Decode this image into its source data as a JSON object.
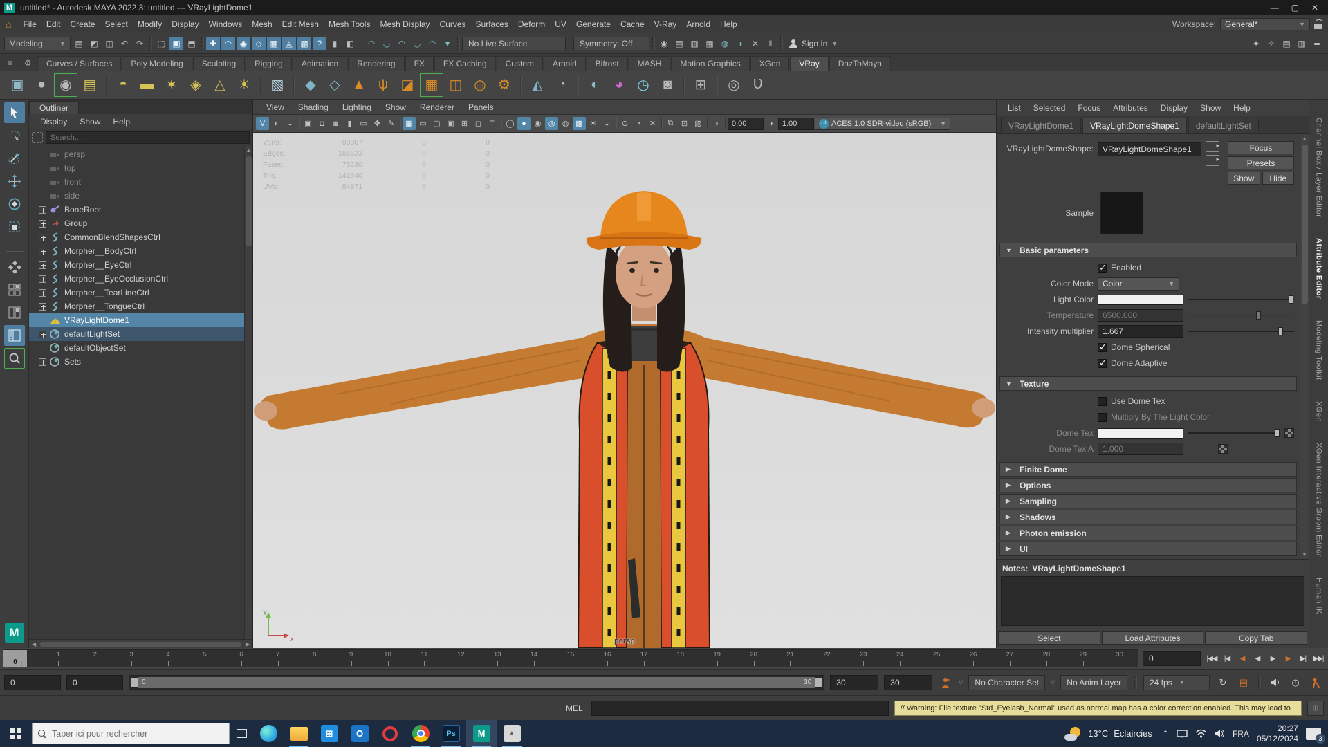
{
  "title_bar": {
    "title": "untitled* - Autodesk MAYA 2022.3: untitled   ---   VRayLightDome1"
  },
  "menu_bar": {
    "items": [
      "File",
      "Edit",
      "Create",
      "Select",
      "Modify",
      "Display",
      "Windows",
      "Mesh",
      "Edit Mesh",
      "Mesh Tools",
      "Mesh Display",
      "Curves",
      "Surfaces",
      "Deform",
      "UV",
      "Generate",
      "Cache",
      "V-Ray",
      "Arnold",
      "Help"
    ],
    "workspace_label": "Workspace:",
    "workspace_value": "General*"
  },
  "status_line": {
    "mode": "Modeling",
    "no_live_surface": "No Live Surface",
    "symmetry": "Symmetry: Off",
    "sign_in": "Sign In",
    "groups": [
      {
        "icons": [
          {
            "n": "new-scene-icon",
            "g": "▤"
          },
          {
            "n": "open-scene-icon",
            "g": "◩"
          },
          {
            "n": "save-scene-icon",
            "g": "◫"
          },
          {
            "n": "undo-icon",
            "g": "↶"
          },
          {
            "n": "redo-icon",
            "g": "↷"
          }
        ]
      },
      {
        "icons": [
          {
            "n": "select-hierarchy-icon",
            "g": "⬚"
          },
          {
            "n": "select-object-icon",
            "g": "▣",
            "a": true
          },
          {
            "n": "select-component-icon",
            "g": "⬒"
          }
        ]
      },
      {
        "icons": [
          {
            "n": "snap-grid-icon",
            "g": "✚",
            "a": true
          },
          {
            "n": "snap-curve-icon",
            "g": "◠",
            "a": true
          },
          {
            "n": "snap-point-icon",
            "g": "◉",
            "a": true
          },
          {
            "n": "snap-plane-icon",
            "g": "◇",
            "a": true
          },
          {
            "n": "snap-mesh-icon",
            "g": "▦",
            "a": true
          },
          {
            "n": "snap-center-icon",
            "g": "◬",
            "a": true
          },
          {
            "n": "make-live-icon",
            "g": "▩",
            "a": true
          },
          {
            "n": "snap-together-icon",
            "g": "?",
            "a": true
          },
          {
            "n": "lock-selection-icon",
            "g": "▮"
          },
          {
            "n": "highlight-icon",
            "g": "◧"
          }
        ]
      },
      {
        "icons": [
          {
            "n": "history-icon-1",
            "g": "◠",
            "t": true
          },
          {
            "n": "history-icon-2",
            "g": "◡",
            "t": true
          },
          {
            "n": "history-icon-3",
            "g": "◠",
            "t": true
          },
          {
            "n": "history-icon-4",
            "g": "◡",
            "t": true
          },
          {
            "n": "history-icon-5",
            "g": "◠",
            "t": true
          },
          {
            "n": "history-dd-icon",
            "g": "▾",
            "t": true
          }
        ]
      }
    ],
    "render_icons": [
      {
        "n": "render-view-icon",
        "g": "◉"
      },
      {
        "n": "render-current-frame-icon",
        "g": "▤"
      },
      {
        "n": "ipr-render-icon",
        "g": "▥"
      },
      {
        "n": "render-sequence-icon",
        "g": "▦"
      },
      {
        "n": "render-settings-icon",
        "g": "◍",
        "t": true
      },
      {
        "n": "toon-icon",
        "g": "◑",
        "t": true
      },
      {
        "n": "cut-icon",
        "g": "✕"
      },
      {
        "n": "pause-icon",
        "g": "‖"
      }
    ],
    "right_icons": [
      {
        "n": "modeling-toolkit-icon",
        "g": "✦"
      },
      {
        "n": "character-controls-icon",
        "g": "✧"
      },
      {
        "n": "channelbox-layout-icon",
        "g": "▤"
      },
      {
        "n": "attribute-layout-icon",
        "g": "▥"
      },
      {
        "n": "layers-icon",
        "g": "≣"
      }
    ]
  },
  "shelf": {
    "tabs": [
      "Curves / Surfaces",
      "Poly Modeling",
      "Sculpting",
      "Rigging",
      "Animation",
      "Rendering",
      "FX",
      "FX Caching",
      "Custom",
      "Arnold",
      "Bifrost",
      "MASH",
      "Motion Graphics",
      "XGen",
      "VRay",
      "DazToMaya"
    ],
    "active_tab": "VRay",
    "icons": [
      {
        "n": "vray-frame-buffer-icon",
        "g": "▣",
        "c": "#8fb8c8"
      },
      {
        "n": "vray-material-icon",
        "g": "●",
        "c": "#b9b9b9"
      },
      {
        "n": "vray-render-icon",
        "g": "◉",
        "c": "#b9b9b9",
        "f": true
      },
      {
        "n": "vray-scene-export-icon",
        "g": "▤",
        "c": "#d8c355"
      },
      {
        "n": "sep"
      },
      {
        "n": "vray-dome-light-icon",
        "g": "◓",
        "c": "#d8c355"
      },
      {
        "n": "vray-rect-light-icon",
        "g": "▬",
        "c": "#d8c355"
      },
      {
        "n": "vray-sphere-light-icon",
        "g": "✶",
        "c": "#d8c355"
      },
      {
        "n": "vray-mesh-light-icon",
        "g": "◈",
        "c": "#d8c355"
      },
      {
        "n": "vray-ies-light-icon",
        "g": "△",
        "c": "#d8c355"
      },
      {
        "n": "vray-sun-light-icon",
        "g": "☀",
        "c": "#d8c355"
      },
      {
        "n": "sep"
      },
      {
        "n": "vray-physical-camera-icon",
        "g": "▧",
        "c": "#bcd8e8"
      },
      {
        "n": "sep"
      },
      {
        "n": "vray-proxy-import-icon",
        "g": "◆",
        "c": "#7fb4c7"
      },
      {
        "n": "vray-proxy-export-icon",
        "g": "◇",
        "c": "#7fb4c7"
      },
      {
        "n": "vray-displacement-icon",
        "g": "▲",
        "c": "#d98c26"
      },
      {
        "n": "vray-fur-icon",
        "g": "ψ",
        "c": "#d98c26"
      },
      {
        "n": "vray-clipper-icon",
        "g": "◪",
        "c": "#d98c26"
      },
      {
        "n": "vray-mesh-export-icon",
        "g": "▦",
        "c": "#d98c26",
        "f": true
      },
      {
        "n": "vray-object-props-icon",
        "g": "◫",
        "c": "#d98c26"
      },
      {
        "n": "vray-vrscene-icon",
        "g": "◍",
        "c": "#d98c26"
      },
      {
        "n": "vray-settings-icon",
        "g": "⚙",
        "c": "#d98c26"
      },
      {
        "n": "sep"
      },
      {
        "n": "vray-volume-icon",
        "g": "◭",
        "c": "#7fb4c7"
      },
      {
        "n": "vray-bake-icon",
        "g": "◔",
        "c": "#b9b9b9"
      },
      {
        "n": "sep"
      },
      {
        "n": "vray-denoise-icon",
        "g": "◐",
        "c": "#8fb8c8"
      },
      {
        "n": "vray-lens-icon",
        "g": "◕",
        "c": "#d06ad0"
      },
      {
        "n": "vray-cosmos-icon",
        "g": "◷",
        "c": "#7fd4e0"
      },
      {
        "n": "vray-chaos-icon",
        "g": "◙",
        "c": "#b9b9b9"
      },
      {
        "n": "sep"
      },
      {
        "n": "vray-node-editor-icon",
        "g": "⊞",
        "c": "#b9b9b9"
      },
      {
        "n": "sep"
      },
      {
        "n": "vray-toolbelt-icon",
        "g": "◎",
        "c": "#b9b9b9"
      },
      {
        "n": "vray-v-icon",
        "g": "Ʋ",
        "c": "#b9b9b9"
      }
    ]
  },
  "outliner": {
    "title": "Outliner",
    "menus": [
      "Display",
      "Show",
      "Help"
    ],
    "search_placeholder": "Search...",
    "items": [
      {
        "label": "persp",
        "icon": "camera",
        "dim": true
      },
      {
        "label": "top",
        "icon": "camera",
        "dim": true
      },
      {
        "label": "front",
        "icon": "camera",
        "dim": true
      },
      {
        "label": "side",
        "icon": "camera",
        "dim": true
      },
      {
        "label": "BoneRoot",
        "icon": "joint",
        "expand": true
      },
      {
        "label": "Group",
        "icon": "group",
        "expand": true
      },
      {
        "label": "CommonBlendShapesCtrl",
        "icon": "curve",
        "expand": true
      },
      {
        "label": "Morpher__BodyCtrl",
        "icon": "curve",
        "expand": true
      },
      {
        "label": "Morpher__EyeCtrl",
        "icon": "curve",
        "expand": true
      },
      {
        "label": "Morpher__EyeOcclusionCtrl",
        "icon": "curve",
        "expand": true
      },
      {
        "label": "Morpher__TearLineCtrl",
        "icon": "curve",
        "expand": true
      },
      {
        "label": "Morpher__TongueCtrl",
        "icon": "curve",
        "expand": true
      },
      {
        "label": "VRayLightDome1",
        "icon": "dome",
        "sel": "main"
      },
      {
        "label": "defaultLightSet",
        "icon": "set",
        "expand": true,
        "sel": "secondary"
      },
      {
        "label": "defaultObjectSet",
        "icon": "set"
      },
      {
        "label": "Sets",
        "icon": "set",
        "expand": true
      }
    ]
  },
  "viewport": {
    "menus": [
      "View",
      "Shading",
      "Lighting",
      "Show",
      "Renderer",
      "Panels"
    ],
    "toolbar": [
      {
        "n": "vray-vfb-icon",
        "g": "V",
        "a": true
      },
      {
        "n": "lighting-toggle-icon",
        "g": "◐"
      },
      {
        "n": "shadows-toggle-icon",
        "g": "◒"
      },
      {
        "n": "sep"
      },
      {
        "n": "select-camera-icon",
        "g": "▣"
      },
      {
        "n": "lock-camera-icon",
        "g": "◘"
      },
      {
        "n": "camera-attributes-icon",
        "g": "◙"
      },
      {
        "n": "bookmark-icon",
        "g": "▮"
      },
      {
        "n": "image-plane-icon",
        "g": "▭"
      },
      {
        "n": "pan-zoom-2d-icon",
        "g": "✥"
      },
      {
        "n": "grease-pencil-icon",
        "g": "✎"
      },
      {
        "n": "sep"
      },
      {
        "n": "grid-icon",
        "g": "▦",
        "a": true
      },
      {
        "n": "film-gate-icon",
        "g": "▭"
      },
      {
        "n": "resolution-gate-icon",
        "g": "▢"
      },
      {
        "n": "gate-mask-icon",
        "g": "▣"
      },
      {
        "n": "field-chart-icon",
        "g": "⊞"
      },
      {
        "n": "safe-action-icon",
        "g": "◻"
      },
      {
        "n": "safe-title-icon",
        "g": "T"
      },
      {
        "n": "sep"
      },
      {
        "n": "wireframe-icon",
        "g": "◯"
      },
      {
        "n": "shaded-icon",
        "g": "●",
        "a": true
      },
      {
        "n": "textured-icon",
        "g": "◉"
      },
      {
        "n": "use-default-material-icon",
        "g": "◎",
        "a": true
      },
      {
        "n": "wireframe-on-shaded-icon",
        "g": "◍"
      },
      {
        "n": "ambient-occlusion-icon",
        "g": "▩",
        "a": true
      },
      {
        "n": "lights-icon",
        "g": "☀"
      },
      {
        "n": "shadows-icon",
        "g": "◒"
      },
      {
        "n": "sep"
      },
      {
        "n": "isolate-select-icon",
        "g": "⊙"
      },
      {
        "n": "xray-icon",
        "g": "◔"
      },
      {
        "n": "joints-xray-icon",
        "g": "✕"
      },
      {
        "n": "sep"
      },
      {
        "n": "separate-layers-icon",
        "g": "⧉"
      },
      {
        "n": "snapshot-icon",
        "g": "⊡"
      },
      {
        "n": "select-highlight-icon",
        "g": "▨"
      },
      {
        "n": "sep"
      },
      {
        "n": "exposure-icon",
        "g": "◑"
      }
    ],
    "exposure": "0.00",
    "gamma": "1.00",
    "colorspace": "ACES 1.0 SDR-video (sRGB)",
    "colorspace_badge": "ctl",
    "camera_label": "persp",
    "hud": [
      {
        "label": "Verts:",
        "value": "80807",
        "c2": "0",
        "c3": "0"
      },
      {
        "label": "Edges:",
        "value": "166523",
        "c2": "0",
        "c3": "0"
      },
      {
        "label": "Faces:",
        "value": "75230",
        "c2": "0",
        "c3": "0"
      },
      {
        "label": "Tris:",
        "value": "141940",
        "c2": "0",
        "c3": "0"
      },
      {
        "label": "UVs:",
        "value": "84871",
        "c2": "0",
        "c3": "0"
      }
    ]
  },
  "attribute_editor": {
    "menus": [
      "List",
      "Selected",
      "Focus",
      "Attributes",
      "Display",
      "Show",
      "Help"
    ],
    "tabs": [
      "VRayLightDome1",
      "VRayLightDomeShape1",
      "defaultLightSet"
    ],
    "active_tab_index": 1,
    "shape_label": "VRayLightDomeShape:",
    "shape_value": "VRayLightDomeShape1",
    "focus_btn": "Focus",
    "presets_btn": "Presets",
    "show_btn": "Show",
    "hide_btn": "Hide",
    "sample_label": "Sample",
    "basic": {
      "title": "Basic parameters",
      "enabled_label": "Enabled",
      "color_mode_label": "Color Mode",
      "color_mode_value": "Color",
      "light_color_label": "Light Color",
      "temperature_label": "Temperature",
      "temperature_value": "6500.000",
      "intensity_label": "Intensity multiplier",
      "intensity_value": "1.667",
      "dome_spherical_label": "Dome Spherical",
      "dome_adaptive_label": "Dome Adaptive"
    },
    "texture": {
      "title": "Texture",
      "use_dome_tex_label": "Use Dome Tex",
      "multiply_label": "Multiply By The Light Color",
      "dome_tex_label": "Dome Tex",
      "dome_tex_a_label": "Dome Tex A",
      "dome_tex_a_value": "1.000"
    },
    "collapsed_sections": [
      "Finite Dome",
      "Options",
      "Sampling",
      "Shadows",
      "Photon emission",
      "UI"
    ],
    "notes_label": "Notes:",
    "notes_value": "VRayLightDomeShape1",
    "buttons": [
      "Select",
      "Load Attributes",
      "Copy Tab"
    ]
  },
  "right_tabs": [
    {
      "label": "Channel Box / Layer Editor"
    },
    {
      "label": "Attribute Editor",
      "active": true
    },
    {
      "label": "Modeling Toolkit"
    },
    {
      "label": "XGen"
    },
    {
      "label": "XGen Interactive Groom Editor"
    },
    {
      "label": "Human IK"
    }
  ],
  "timeline": {
    "ticks": [
      "0",
      "1",
      "2",
      "3",
      "4",
      "5",
      "6",
      "7",
      "8",
      "9",
      "10",
      "11",
      "12",
      "13",
      "14",
      "15",
      "16",
      "17",
      "18",
      "19",
      "20",
      "21",
      "22",
      "23",
      "24",
      "25",
      "26",
      "27",
      "28",
      "29",
      "30"
    ],
    "current": "0",
    "frame_field": "0",
    "playback": [
      {
        "n": "go-to-start-icon",
        "g": "|◀◀"
      },
      {
        "n": "step-back-frame-icon",
        "g": "|◀"
      },
      {
        "n": "step-back-key-icon",
        "g": "◀",
        "orange": true
      },
      {
        "n": "play-backwards-icon",
        "g": "◀"
      },
      {
        "n": "play-forward-icon",
        "g": "▶"
      },
      {
        "n": "step-forward-key-icon",
        "g": "▶",
        "orange": true
      },
      {
        "n": "step-forward-frame-icon",
        "g": "▶|"
      },
      {
        "n": "go-to-end-icon",
        "g": "▶▶|"
      }
    ]
  },
  "range": {
    "anim_start": "0",
    "playback_start": "0",
    "bar_start_label": "0",
    "bar_end_label": "30",
    "playback_end": "30",
    "anim_end": "30",
    "character_set": "No Character Set",
    "anim_layer": "No Anim Layer",
    "fps": "24 fps"
  },
  "command_line": {
    "label": "MEL",
    "warning": "// Warning: File texture \"Std_Eyelash_Normal\" used as normal map has a color correction enabled. This may lead to"
  },
  "taskbar": {
    "search_placeholder": "Taper ici pour rechercher",
    "apps": [
      {
        "n": "edge-icon",
        "kind": "edge"
      },
      {
        "n": "file-explorer-icon",
        "kind": "explorer",
        "running": true
      },
      {
        "n": "microsoft-store-icon",
        "kind": "store"
      },
      {
        "n": "outlook-icon",
        "kind": "outlook"
      },
      {
        "n": "opera-icon",
        "kind": "opera"
      },
      {
        "n": "chrome-icon",
        "kind": "chrome",
        "running": true
      },
      {
        "n": "photoshop-icon",
        "kind": "ps",
        "text": "Ps",
        "running": true
      },
      {
        "n": "maya-icon",
        "kind": "maya",
        "text": "M",
        "running": true,
        "active": true
      },
      {
        "n": "daz-icon",
        "kind": "daz",
        "running": true
      }
    ],
    "temp": "13°C",
    "weather": "Eclaircies",
    "lang": "FRA",
    "time": "20:27",
    "date": "05/12/2024",
    "badge": "3"
  }
}
